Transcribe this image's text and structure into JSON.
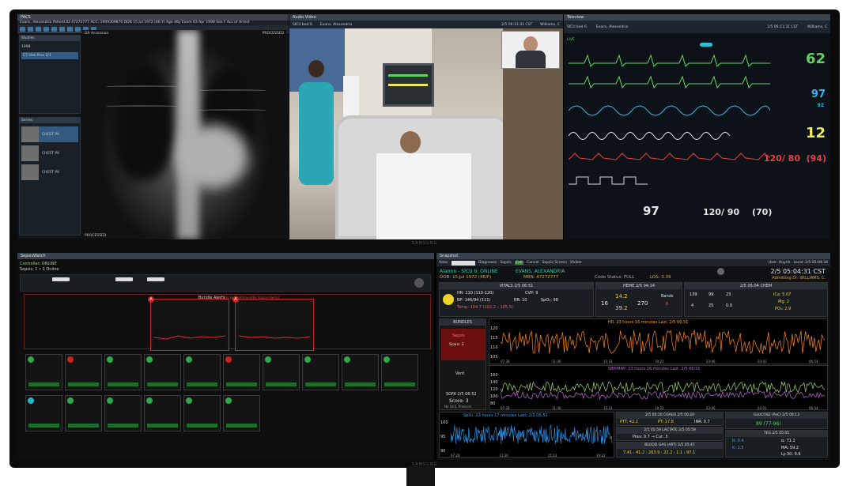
{
  "brand": "SAMSUNG",
  "pacs": {
    "title": "PACS",
    "patient_bar": "Evans, Alexandria    Patient ID 47272777    ACC: 1909309876    DOB 15 Jul 1972 (46 Y)    Age 46y    Exam 03 Apr 1998    Sex F    Acc of Arrest",
    "studies_header": "Studies",
    "year": "1998",
    "study_row": "CT Hist  Proc 2/1",
    "series_header": "Series",
    "thumb_label_1": "CHEST PA",
    "thumb_label_2": "CHEST PA",
    "thumb_label_3": "CHEST PA",
    "xray_label_tl": "DX  Accession",
    "xray_label_tr": "PROCESSED",
    "xray_label_bl": "PROCESSED"
  },
  "video": {
    "title": "Audio Video",
    "location": "SICU bed 6",
    "patient": "Evans, Alexandria",
    "time": "2/5 06:11:31 CST",
    "clinician": "Williams, C"
  },
  "tele": {
    "title": "Teleview",
    "location": "SICU bed 6",
    "patient": "Evans, Alexandria",
    "time": "2/5 06:11:31 CST",
    "clinician": "Williams, C",
    "live": "LIVE",
    "hr": "62",
    "spo2": "97",
    "spo2_sub": "92",
    "rr": "12",
    "abp": "120/ 80",
    "abp_map": "(94)",
    "temp": "97",
    "nibp": "120/ 90",
    "nibp_map": "(70)"
  },
  "sepsis": {
    "title": "SepsisWatch",
    "controller": "Controller:  ONLINE",
    "sepsis_line": "Sepsis:  1  • 1 Online",
    "bundle_title": "Bundle Alerts",
    "bundle_sub": "Timing (Confirmed/By Sepsis Alerts)",
    "status_online": "ONLINE"
  },
  "snap": {
    "title": "Snapshot",
    "view_label": "View:",
    "diag_label": "Diagnoses",
    "sepsis_tab": "Sepsis",
    "fall_tab": "Fall",
    "cancel_tab": "Cancel",
    "sepsis_screen_tab": "Sepsis Screen",
    "visible_tab": "Visible",
    "user": "User: Huynh",
    "local": "Local: 2/5 05:04:34",
    "alarm": "Alarmo - SICU 6: ONLINE",
    "patient": "EVANS, ALEXANDRIA",
    "dob": "DOB: 15 Jul 1972 (46/F)",
    "mrn": "MRN: 47272777",
    "code": "Code Status: FULL",
    "los": "LOS: 3.39",
    "clock": "2/5 05:04:31 CST",
    "attending": "Admitting Dr: WILLIAMS, C.",
    "vitals_head": "VITALS 2/5 06:51",
    "hr": "HR: 110 (110-120)",
    "cvp": "CVP: 9",
    "bp": "BP: 146/94 (111)",
    "rr": "RR: 10",
    "spo2": "SpO₂: 98",
    "temp": "Temp: 104.7 (102.2 – 105.5)",
    "heme_head": "HEME 2/5 04:14",
    "heme_wbc": "14.2",
    "heme_hgb": "39.2",
    "heme_l": "16",
    "heme_plt": "270",
    "bands": "Bands",
    "bands_val": "8",
    "chem_head": "2/5 05:04 CHEM",
    "chem_vals": [
      "139",
      "99",
      "23",
      "4",
      "25",
      "0.9"
    ],
    "ica": "iCa: 5.07",
    "mg": "Mg: 2",
    "po4": "PO₄: 2.9",
    "bundles_head": "BUNDLES",
    "sepsis_alert": "Sepsis",
    "sepsis_score": "Score: 3",
    "vent": "Vent",
    "sofa": "SOFA 2/5 06:52",
    "sofa_score": "Score: 3",
    "sofa_note": "No GCS, Pressors",
    "hr_chart_title": "HR: 23 hours 16 minutes  Last: 2/5 06:51",
    "sbp_chart_title": "SBP/MAP: 23 hours 16 minutes  Last: 2/5 06:51",
    "spo2_chart_title": "SpO₂: 23 hours 17 minutes  Last: 2/5 06:51",
    "hr_y": [
      "120",
      "115",
      "110",
      "105"
    ],
    "sbp_y": [
      "160",
      "140",
      "120",
      "100",
      "80"
    ],
    "spo2_y": [
      "100",
      "95",
      "90"
    ],
    "x_ticks": [
      "07:28",
      "11:30",
      "15:23",
      "19:22",
      "23:06",
      "03:01",
      "06:54"
    ],
    "coags_head": "2/5 06:20 COAGS 2/5 06:20",
    "ptt": "PTT: 42.2",
    "pt": "PT: 17.8",
    "inr": "INR: 0.7",
    "lactate_head": "2/5 05:59 LACTATE 2/5 05:59",
    "lactate": "Prev: 0.7 → Cur: 3",
    "bg_head": "BLOOD GAS (ART) 2/5 05:47",
    "bg": "7.41 : 41.2 : 263.9 : 22.2 : 1.1 : 97.1",
    "glucose_head": "GLUCOSE (PoC) 2/5 06:13",
    "glucose": "89 (77-96)",
    "teg_head": "TEG 2/5 05:05",
    "teg_r": "R: 0.4",
    "teg_k": "K: 1.5",
    "teg_a": "α: 71.1",
    "teg_ma": "MA: 59.2",
    "teg_ly": "Ly-30: 0.6"
  }
}
